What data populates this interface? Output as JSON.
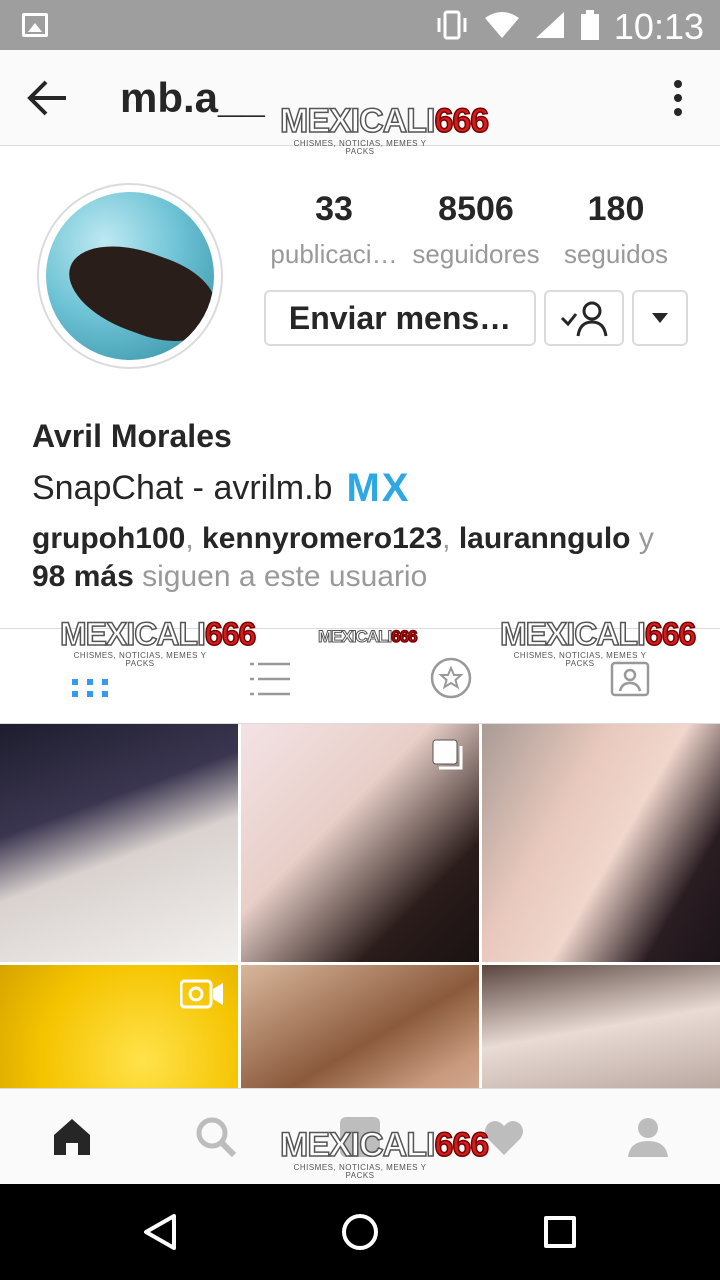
{
  "status_bar": {
    "time": "10:13"
  },
  "header": {
    "username": "mb.a__"
  },
  "watermark": {
    "brand_main": "MEXICALI",
    "brand_num": "666",
    "tagline": "CHISMES, NOTICIAS, MEMES Y PACKS"
  },
  "stats": [
    {
      "value": "33",
      "label": "publicaci…"
    },
    {
      "value": "8506",
      "label": "seguidores"
    },
    {
      "value": "180",
      "label": "seguidos"
    }
  ],
  "actions": {
    "message_label": "Enviar mens…"
  },
  "profile": {
    "full_name": "Avril Morales",
    "bio": "SnapChat - avrilm.b",
    "bio_flag": "MX"
  },
  "followed_by": {
    "users": [
      "grupoh100",
      "kennyromero123",
      "lauranngulo"
    ],
    "conj": "y",
    "more": "98 más",
    "suffix": "siguen a este usuario"
  },
  "tabs": [
    "grid-tab",
    "list-tab",
    "saved-tab",
    "tagged-tab"
  ],
  "accent_color": "#3897f0"
}
